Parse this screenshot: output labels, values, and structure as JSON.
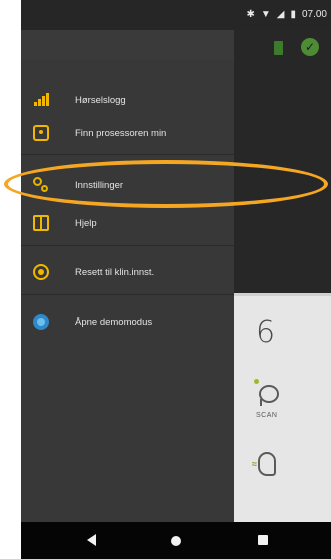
{
  "status_bar": {
    "time": "07.00",
    "icons": [
      "bluetooth-icon",
      "wifi-icon",
      "signal-icon",
      "battery-icon"
    ]
  },
  "drawer": {
    "items": [
      {
        "label": "Hørselslogg",
        "icon": "signal-bars-icon"
      },
      {
        "label": "Finn prosessoren min",
        "icon": "map-pin-icon"
      },
      {
        "label": "Innstillinger",
        "icon": "settings-gears-icon"
      },
      {
        "label": "Hjelp",
        "icon": "book-icon"
      },
      {
        "label": "Resett til klin.innst.",
        "icon": "reset-icon"
      },
      {
        "label": "Åpne demomodus",
        "icon": "demo-globe-icon"
      }
    ]
  },
  "background_app": {
    "program_number": "6",
    "scan_label": "SCAN"
  },
  "colors": {
    "accent": "#f2b800",
    "annotation": "#f5a623",
    "drawer_bg": "#383838"
  }
}
